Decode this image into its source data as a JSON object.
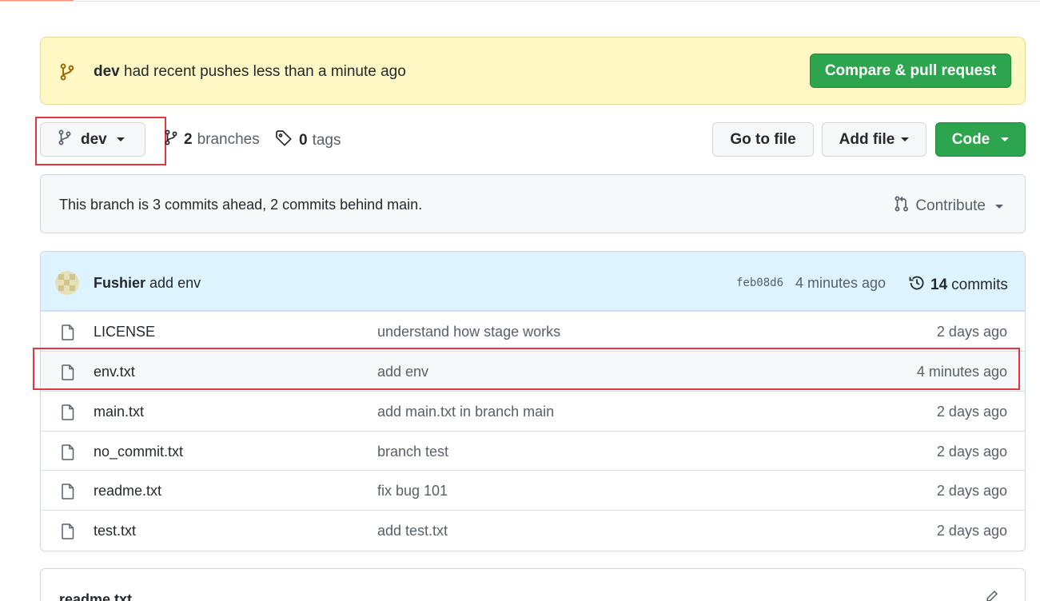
{
  "banner": {
    "branch": "dev",
    "message": "had recent pushes less than a minute ago",
    "compare_button": "Compare & pull request"
  },
  "toolbar": {
    "branch_name": "dev",
    "branches_count": "2",
    "branches_label": "branches",
    "tags_count": "0",
    "tags_label": "tags",
    "go_to_file": "Go to file",
    "add_file": "Add file",
    "code": "Code"
  },
  "branch_info": {
    "text": "This branch is 3 commits ahead, 2 commits behind main.",
    "contribute": "Contribute"
  },
  "latest_commit": {
    "author": "Fushier",
    "message": "add env",
    "sha": "feb08d6",
    "time": "4 minutes ago",
    "commit_count": "14",
    "commits_label": "commits"
  },
  "files": [
    {
      "name": "LICENSE",
      "message": "understand how stage works",
      "age": "2 days ago"
    },
    {
      "name": "env.txt",
      "message": "add env",
      "age": "4 minutes ago"
    },
    {
      "name": "main.txt",
      "message": "add main.txt in branch main",
      "age": "2 days ago"
    },
    {
      "name": "no_commit.txt",
      "message": "branch test",
      "age": "2 days ago"
    },
    {
      "name": "readme.txt",
      "message": "fix bug 101",
      "age": "2 days ago"
    },
    {
      "name": "test.txt",
      "message": "add test.txt",
      "age": "2 days ago"
    }
  ],
  "readme": {
    "title": "readme.txt"
  },
  "colors": {
    "primary_green": "#2da44e",
    "banner_yellow": "#fff8c5",
    "commit_header_blue": "#ddf4ff",
    "highlight_red": "#e0383e"
  },
  "icons": [
    "git-branch-icon",
    "tag-icon",
    "history-icon",
    "file-icon",
    "git-pull-request-icon",
    "pencil-icon"
  ]
}
